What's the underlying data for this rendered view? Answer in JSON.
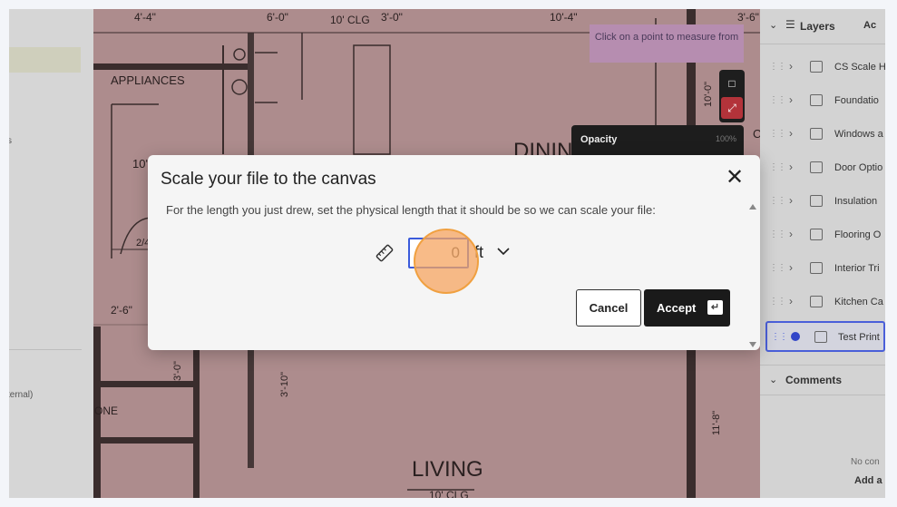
{
  "left_panel": {
    "fragment_1": "s",
    "fragment_2": "ternal)"
  },
  "blueprint": {
    "labels": {
      "dim_4_4": "4'-4\"",
      "dim_6_0": "6'-0\"",
      "ceiling_1": "10' CLG",
      "dim_3_0": "3'-0\"",
      "dim_10_4": "10'-4\"",
      "dim_3_6": "3'-6\"",
      "appliances": "APPLIANCES",
      "dim_10_0": "10'-0\"",
      "dining": "DINING",
      "clg_frag": "CL",
      "ceiling_frag": "10' C",
      "dim_2_4": "2/4",
      "dim_2_6": "2'-6\"",
      "dim_3_0v": "3'-0\"",
      "dim_3_10": "3'-10\"",
      "one": "ONE",
      "dim_11_8": "11'-8\"",
      "living": "LIVING",
      "ceiling_2": "10' CLG"
    },
    "measure_hint": "Click on a point to measure from",
    "opacity_label": "Opacity",
    "opacity_value": "100%"
  },
  "layers_panel": {
    "title": "Layers",
    "add_label": "Ac",
    "layers": [
      {
        "name": "CS Scale H"
      },
      {
        "name": "Foundatio"
      },
      {
        "name": "Windows a"
      },
      {
        "name": "Door Optio"
      },
      {
        "name": "Insulation"
      },
      {
        "name": "Flooring O"
      },
      {
        "name": "Interior Tri"
      },
      {
        "name": "Kitchen Ca"
      }
    ],
    "selected_layer": {
      "name": "Test Print"
    },
    "comments_title": "Comments",
    "no_comments": "No con",
    "add_comment": "Add a"
  },
  "modal": {
    "title": "Scale your file to the canvas",
    "description": "For the length you just drew, set the physical length that it should be so we can scale your file:",
    "length_value": "0",
    "unit": "ft",
    "cancel_label": "Cancel",
    "accept_label": "Accept"
  },
  "colors": {
    "blueprint_tint": "#ad8c8d",
    "accent_blue": "#3b5bdb",
    "accept_bg": "#1a1a1a",
    "click_highlight": "#f6a460"
  }
}
